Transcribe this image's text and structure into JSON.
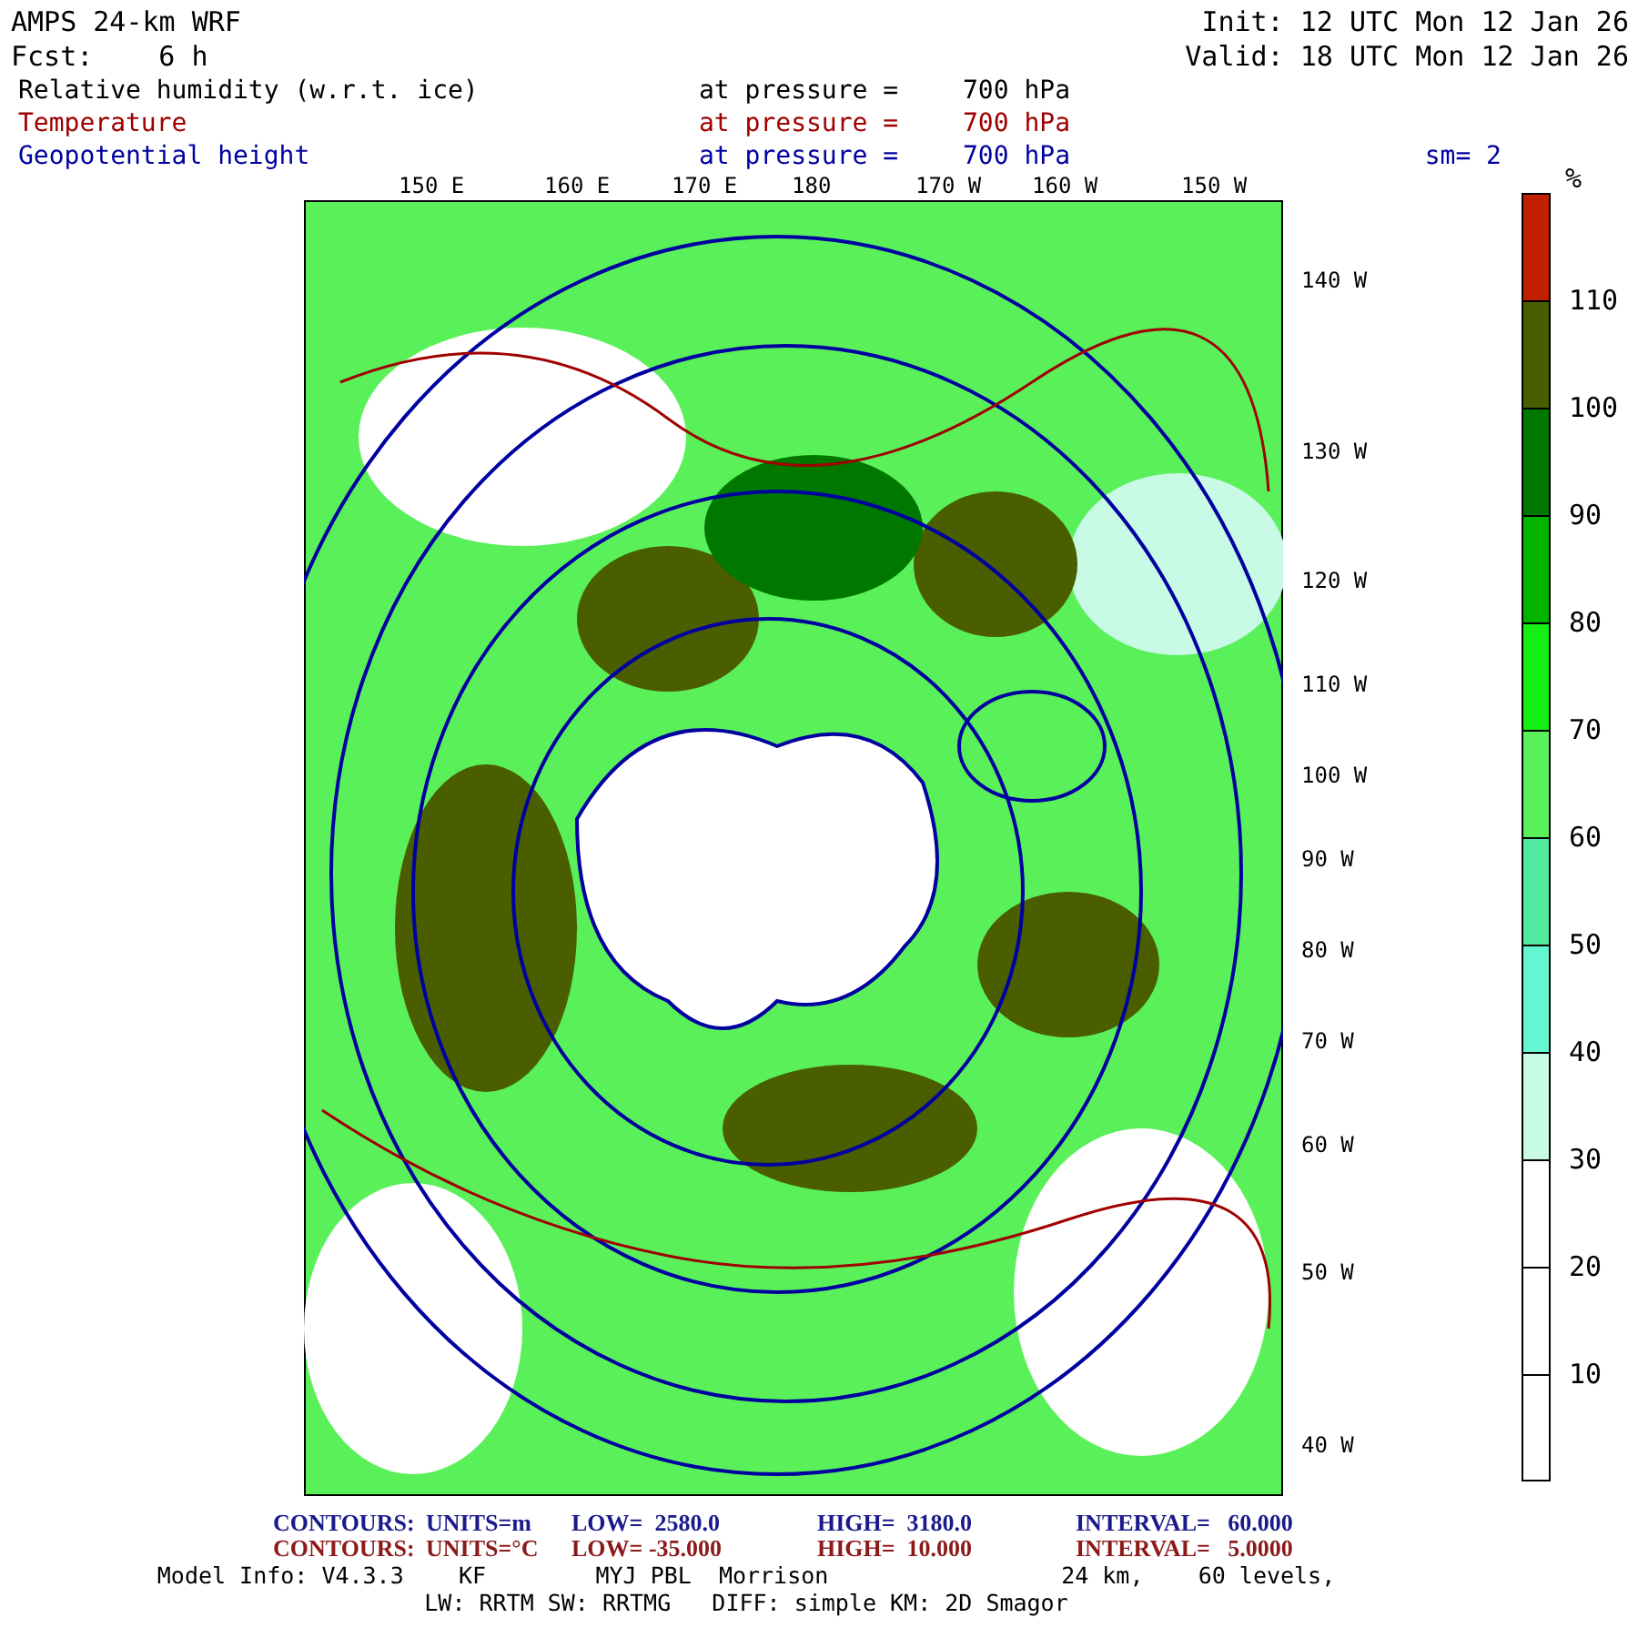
{
  "header": {
    "title": "AMPS 24-km WRF",
    "forecast_label": "Fcst:",
    "forecast_value": "6 h",
    "init": "Init: 12 UTC Mon 12 Jan 26",
    "valid": "Valid: 18 UTC Mon 12 Jan 26"
  },
  "fields": [
    {
      "name": "Relative humidity (w.r.t. ice)",
      "level_label": "at pressure =",
      "level_value": "700 hPa",
      "color": "#000000"
    },
    {
      "name": "Temperature",
      "level_label": "at pressure =",
      "level_value": "700 hPa",
      "color": "#a00000"
    },
    {
      "name": "Geopotential height",
      "level_label": "at pressure =",
      "level_value": "700 hPa",
      "color": "#0000a0"
    }
  ],
  "smoothing": "sm= 2",
  "map": {
    "top_axis": [
      "150 E",
      "160 E",
      "170 E",
      "180",
      "170 W",
      "160 W",
      "150 W"
    ],
    "right_axis": [
      "140 W",
      "130 W",
      "120 W",
      "110 W",
      "100 W",
      "90 W",
      "80 W",
      "70 W",
      "60 W",
      "50 W",
      "40 W"
    ]
  },
  "colorbar": {
    "unit": "%",
    "bins": [
      {
        "color": "#c02000",
        "label": "110"
      },
      {
        "color": "#4a5e00",
        "label": "100"
      },
      {
        "color": "#007800",
        "label": "90"
      },
      {
        "color": "#00b400",
        "label": "80"
      },
      {
        "color": "#14f014",
        "label": "70"
      },
      {
        "color": "#5af05a",
        "label": "60"
      },
      {
        "color": "#50eba0",
        "label": "50"
      },
      {
        "color": "#64f5d2",
        "label": "40"
      },
      {
        "color": "#c8fae6",
        "label": "30"
      },
      {
        "color": "#ffffff",
        "label": "20"
      },
      {
        "color": "#ffffff",
        "label": "10"
      },
      {
        "color": "#ffffff"
      }
    ]
  },
  "footer": {
    "contours": [
      {
        "label": "CONTOURS:",
        "units": "UNITS=m",
        "low": "LOW=  2580.0",
        "high": "HIGH=  3180.0",
        "interval": "INTERVAL=   60.000",
        "color": "#1a1a8c"
      },
      {
        "label": "CONTOURS:",
        "units": "UNITS=°C",
        "low": "LOW= -35.000",
        "high": "HIGH=  10.000",
        "interval": "INTERVAL=   5.0000",
        "color": "#8c1a1a"
      }
    ],
    "model_info": [
      {
        "text": "Model Info: V4.3.3    KF        MYJ PBL  Morrison                 24 km,    60 levels,"
      },
      {
        "text": "LW: RRTM SW: RRTMG   DIFF: simple KM: 2D Smagor"
      }
    ]
  }
}
